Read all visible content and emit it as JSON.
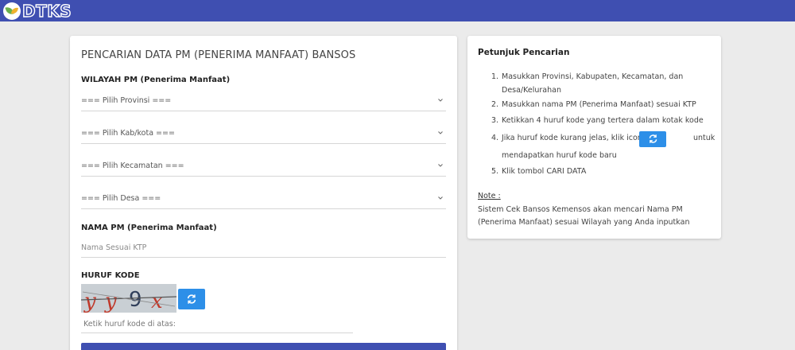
{
  "header": {
    "logo_text": "DTKS",
    "colors": {
      "bar": "#3f4fb1",
      "accent": "#2d8fe8"
    }
  },
  "form": {
    "title": "PENCARIAN DATA PM (PENERIMA MANFAAT) BANSOS",
    "wilayah_label": "WILAYAH PM (Penerima Manfaat)",
    "provinsi": "=== Pilih Provinsi ===",
    "kabkota": "=== Pilih Kab/kota ===",
    "kecamatan": "=== Pilih Kecamatan ===",
    "desa": "=== Pilih Desa ===",
    "nama_label": "NAMA PM (Penerima Manfaat)",
    "nama_placeholder": "Nama Sesuai KTP",
    "kode_label": "HURUF KODE",
    "captcha_text": "yy9x",
    "kode_placeholder": "Ketik huruf kode di atas:"
  },
  "guide": {
    "title": "Petunjuk Pencarian",
    "steps": [
      {
        "num": "1.",
        "line1": "Masukkan Provinsi, Kabupaten, Kecamatan, dan",
        "line2": "Desa/Kelurahan"
      },
      {
        "num": "2.",
        "line1": "Masukkan nama PM (Penerima Manfaat) sesuai KTP"
      },
      {
        "num": "3.",
        "line1": "Ketikkan 4 huruf kode yang tertera dalam kotak kode"
      },
      {
        "num": "4.",
        "pre": "Jika huruf kode kurang jelas, klik icon",
        "post": "untuk",
        "line2": "mendapatkan huruf kode baru"
      },
      {
        "num": "5.",
        "line1": "Klik tombol CARI DATA"
      }
    ],
    "note_label": "Note :",
    "note_text": "Sistem Cek Bansos Kemensos akan mencari Nama PM (Penerima Manfaat) sesuai Wilayah yang Anda inputkan"
  }
}
